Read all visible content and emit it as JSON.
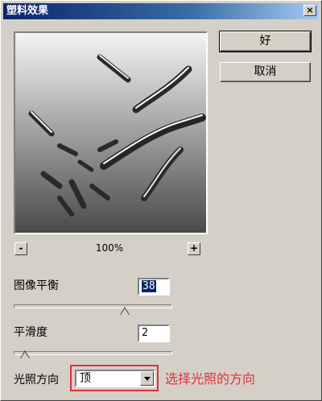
{
  "window": {
    "title": "塑料效果",
    "close_glyph": "×"
  },
  "buttons": {
    "ok_label": "好",
    "cancel_label": "取消"
  },
  "zoom": {
    "minus_label": "-",
    "plus_label": "+",
    "level": "100%"
  },
  "controls": {
    "image_balance": {
      "label": "图像平衡",
      "value": "38",
      "slider_fraction": 0.7
    },
    "smoothness": {
      "label": "平滑度",
      "value": "2",
      "slider_fraction": 0.07
    },
    "light_direction": {
      "label": "光照方向",
      "value": "顶"
    }
  },
  "annotation": {
    "text": "选择光照的方向",
    "color": "#e0303a"
  },
  "colors": {
    "dialog_bg": "#d4d0c8",
    "title_bar": "#0a246a",
    "selection": "#0a246a"
  }
}
